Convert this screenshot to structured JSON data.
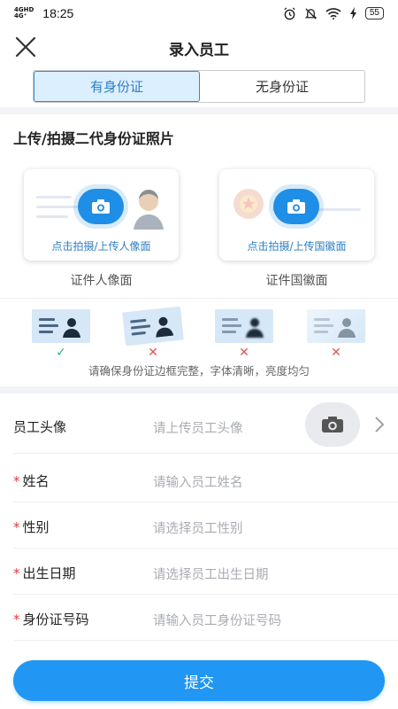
{
  "status_bar": {
    "network_top": "4GHD",
    "network_bottom": "4G⁺",
    "time": "18:25",
    "battery": "55"
  },
  "nav": {
    "title": "录入员工"
  },
  "tabs": [
    {
      "label": "有身份证",
      "active": true
    },
    {
      "label": "无身份证",
      "active": false
    }
  ],
  "upload": {
    "title": "上传/拍摄二代身份证照片",
    "front": {
      "link": "点击拍摄/上传人像面",
      "caption": "证件人像面"
    },
    "back": {
      "link": "点击拍摄/上传国徽面",
      "caption": "证件国徽面"
    }
  },
  "examples": {
    "marks": [
      "✓",
      "✕",
      "✕",
      "✕"
    ],
    "hint": "请确保身份证边框完整，字体清晰，亮度均匀"
  },
  "form": {
    "avatar": {
      "label": "员工头像",
      "placeholder": "请上传员工头像"
    },
    "name": {
      "required": "*",
      "label": "姓名",
      "placeholder": "请输入员工姓名"
    },
    "gender": {
      "required": "*",
      "label": "性别",
      "placeholder": "请选择员工性别"
    },
    "birthdate": {
      "required": "*",
      "label": "出生日期",
      "placeholder": "请选择员工出生日期"
    },
    "id_number": {
      "required": "*",
      "label": "身份证号码",
      "placeholder": "请输入员工身份证号码"
    }
  },
  "submit_label": "提交",
  "colors": {
    "accent": "#2196f3",
    "tab_active_bg": "#dcefff",
    "required": "#e03a3a"
  },
  "icons": [
    "close-icon",
    "alarm-icon",
    "mute-icon",
    "wifi-icon",
    "charging-icon",
    "camera-icon",
    "chevron-right-icon",
    "check-icon",
    "cross-icon"
  ]
}
